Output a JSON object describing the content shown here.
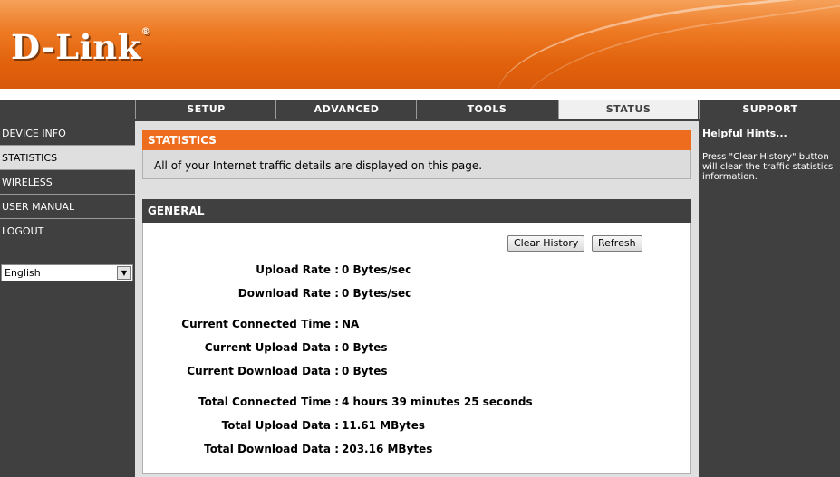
{
  "header": {
    "logo_text": "D-Link",
    "logo_mark": "®"
  },
  "nav": {
    "tabs": [
      {
        "label": "SETUP",
        "active": false
      },
      {
        "label": "ADVANCED",
        "active": false
      },
      {
        "label": "TOOLS",
        "active": false
      },
      {
        "label": "STATUS",
        "active": true
      },
      {
        "label": "SUPPORT",
        "active": false
      }
    ]
  },
  "sidebar": {
    "items": [
      {
        "label": "DEVICE INFO",
        "active": false
      },
      {
        "label": "STATISTICS",
        "active": true
      },
      {
        "label": "WIRELESS",
        "active": false
      },
      {
        "label": "USER MANUAL",
        "active": false
      },
      {
        "label": "LOGOUT",
        "active": false
      }
    ],
    "language": "English"
  },
  "statistics": {
    "title": "STATISTICS",
    "description": "All of your Internet traffic details are displayed on this page."
  },
  "general": {
    "title": "GENERAL",
    "clear_history_label": "Clear History",
    "refresh_label": "Refresh",
    "rows": [
      {
        "label": "Upload Rate :",
        "value": "0 Bytes/sec"
      },
      {
        "label": "Download Rate :",
        "value": "0 Bytes/sec"
      },
      {
        "label": "Current Connected Time :",
        "value": "NA"
      },
      {
        "label": "Current Upload Data :",
        "value": "0 Bytes"
      },
      {
        "label": "Current Download Data :",
        "value": "0 Bytes"
      },
      {
        "label": "Total Connected Time :",
        "value": "4 hours 39 minutes 25 seconds"
      },
      {
        "label": "Total Upload Data :",
        "value": "11.61 MBytes"
      },
      {
        "label": "Total Download Data :",
        "value": "203.16 MBytes"
      }
    ]
  },
  "hints": {
    "title": "Helpful Hints...",
    "text": "Press \"Clear History\" button will clear the traffic statistics information."
  },
  "colors": {
    "brand_orange": "#ee6c1e",
    "dark_grey": "#404040",
    "panel_grey": "#dfdfdf"
  }
}
